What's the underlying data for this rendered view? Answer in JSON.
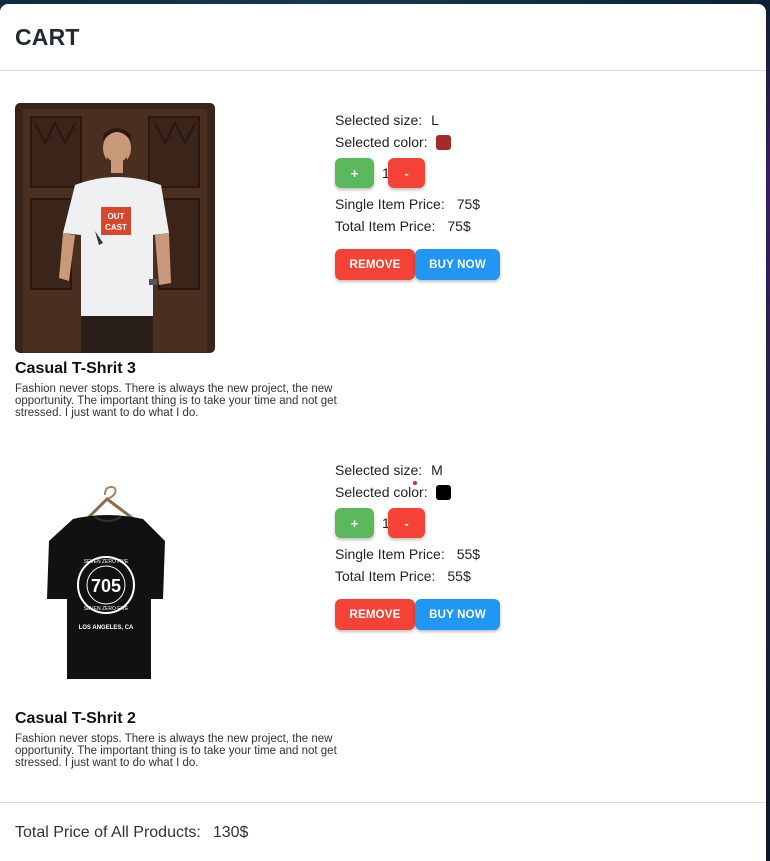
{
  "cart": {
    "title": "CART",
    "labels": {
      "selected_size": "Selected size:",
      "selected_color": "Selected color:",
      "single_price": "Single Item Price:",
      "total_price": "Total Item Price:",
      "plus": "+",
      "minus": "-",
      "remove": "REMOVE",
      "buy_now": "BUY NOW"
    },
    "items": [
      {
        "name": "Casual T-Shrit 3",
        "description": "Fashion never stops. There is always the new project, the new opportunity. The important thing is to take your time and not get stressed. I just want to do what I do.",
        "size": "L",
        "color": "#a52a2a",
        "quantity": "1",
        "single_price": "75$",
        "total_price": "75$",
        "image_icon": "man-white-tshirt-photo",
        "shirt_print_text": "OUT CAST"
      },
      {
        "name": "Casual T-Shrit 2",
        "description": "Fashion never stops. There is always the new project, the new opportunity. The important thing is to take your time and not get stressed. I just want to do what I do.",
        "size": "M",
        "color": "#000000",
        "quantity": "1",
        "single_price": "55$",
        "total_price": "55$",
        "image_icon": "black-tshirt-on-hanger",
        "shirt_print_text": "705",
        "shirt_ring_text": "SEVEN ZERO FIVE",
        "shirt_city_text": "LOS ANGELES, CA"
      }
    ],
    "footer": {
      "label": "Total Price of All Products:",
      "value": "130$"
    }
  }
}
